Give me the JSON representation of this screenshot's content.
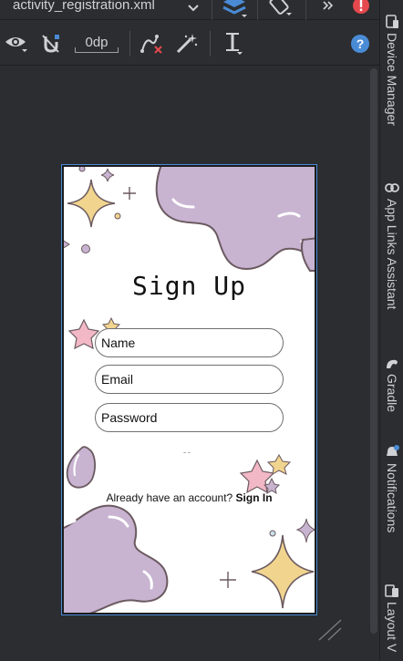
{
  "tab": {
    "title": "activity_registration.xml"
  },
  "toolbar": {
    "default_margin": "0dp"
  },
  "right_sidebar": {
    "items": [
      {
        "label": "Device Manager"
      },
      {
        "label": "App Links Assistant"
      },
      {
        "label": "Gradle"
      },
      {
        "label": "Notifications"
      },
      {
        "label": "Layout V"
      }
    ]
  },
  "preview": {
    "title": "Sign Up",
    "name_hint": "Name",
    "email_hint": "Email",
    "password_hint": "Password",
    "tiny_text": "~ ~",
    "signin_prompt": "Already have an account?",
    "signin_link": "Sign In"
  },
  "colors": {
    "ide_background": "#2b2d30",
    "accent_blue": "#4a8bd6",
    "error_red": "#e5484d",
    "blob_purple": "#c8b3d1",
    "star_gold": "#f1d48e",
    "star_pink": "#f2b8c6"
  }
}
